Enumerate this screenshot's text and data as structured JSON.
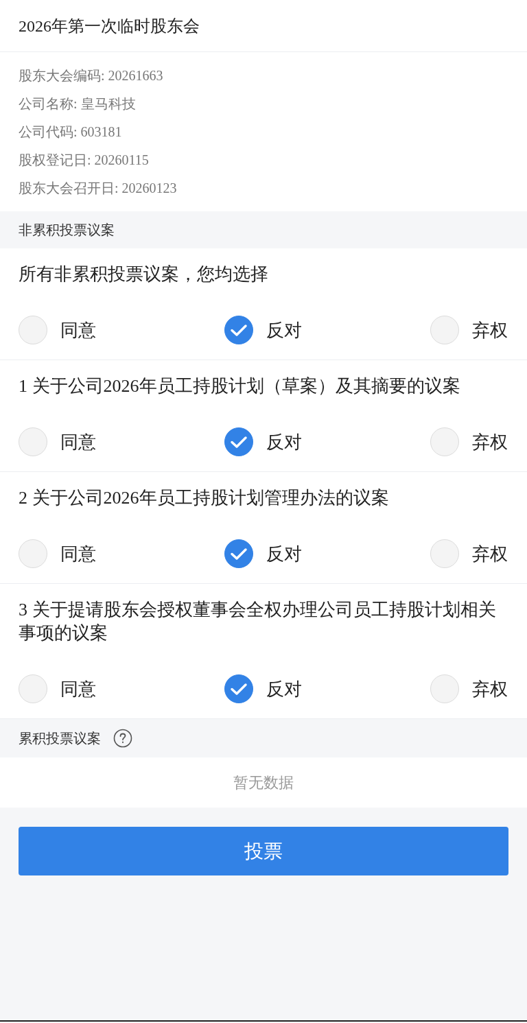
{
  "title": "2026年第一次临时股东会",
  "info": [
    "股东大会编码: 20261663",
    "公司名称: 皇马科技",
    "公司代码: 603181",
    "股权登记日: 20260115",
    "股东大会召开日: 20260123"
  ],
  "non_cumulative": {
    "heading": "非累积投票议案",
    "proposals": [
      {
        "title": "所有非累积投票议案，您均选择",
        "options": [
          {
            "label": "同意",
            "selected": false
          },
          {
            "label": "反对",
            "selected": true
          },
          {
            "label": "弃权",
            "selected": false
          }
        ]
      },
      {
        "title": "1 关于公司2026年员工持股计划（草案）及其摘要的议案",
        "options": [
          {
            "label": "同意",
            "selected": false
          },
          {
            "label": "反对",
            "selected": true
          },
          {
            "label": "弃权",
            "selected": false
          }
        ]
      },
      {
        "title": "2 关于公司2026年员工持股计划管理办法的议案",
        "options": [
          {
            "label": "同意",
            "selected": false
          },
          {
            "label": "反对",
            "selected": true
          },
          {
            "label": "弃权",
            "selected": false
          }
        ]
      },
      {
        "title": "3 关于提请股东会授权董事会全权办理公司员工持股计划相关事项的议案",
        "options": [
          {
            "label": "同意",
            "selected": false
          },
          {
            "label": "反对",
            "selected": true
          },
          {
            "label": "弃权",
            "selected": false
          }
        ]
      }
    ]
  },
  "cumulative": {
    "heading": "累积投票议案",
    "empty_text": "暂无数据"
  },
  "submit_button": "投票"
}
